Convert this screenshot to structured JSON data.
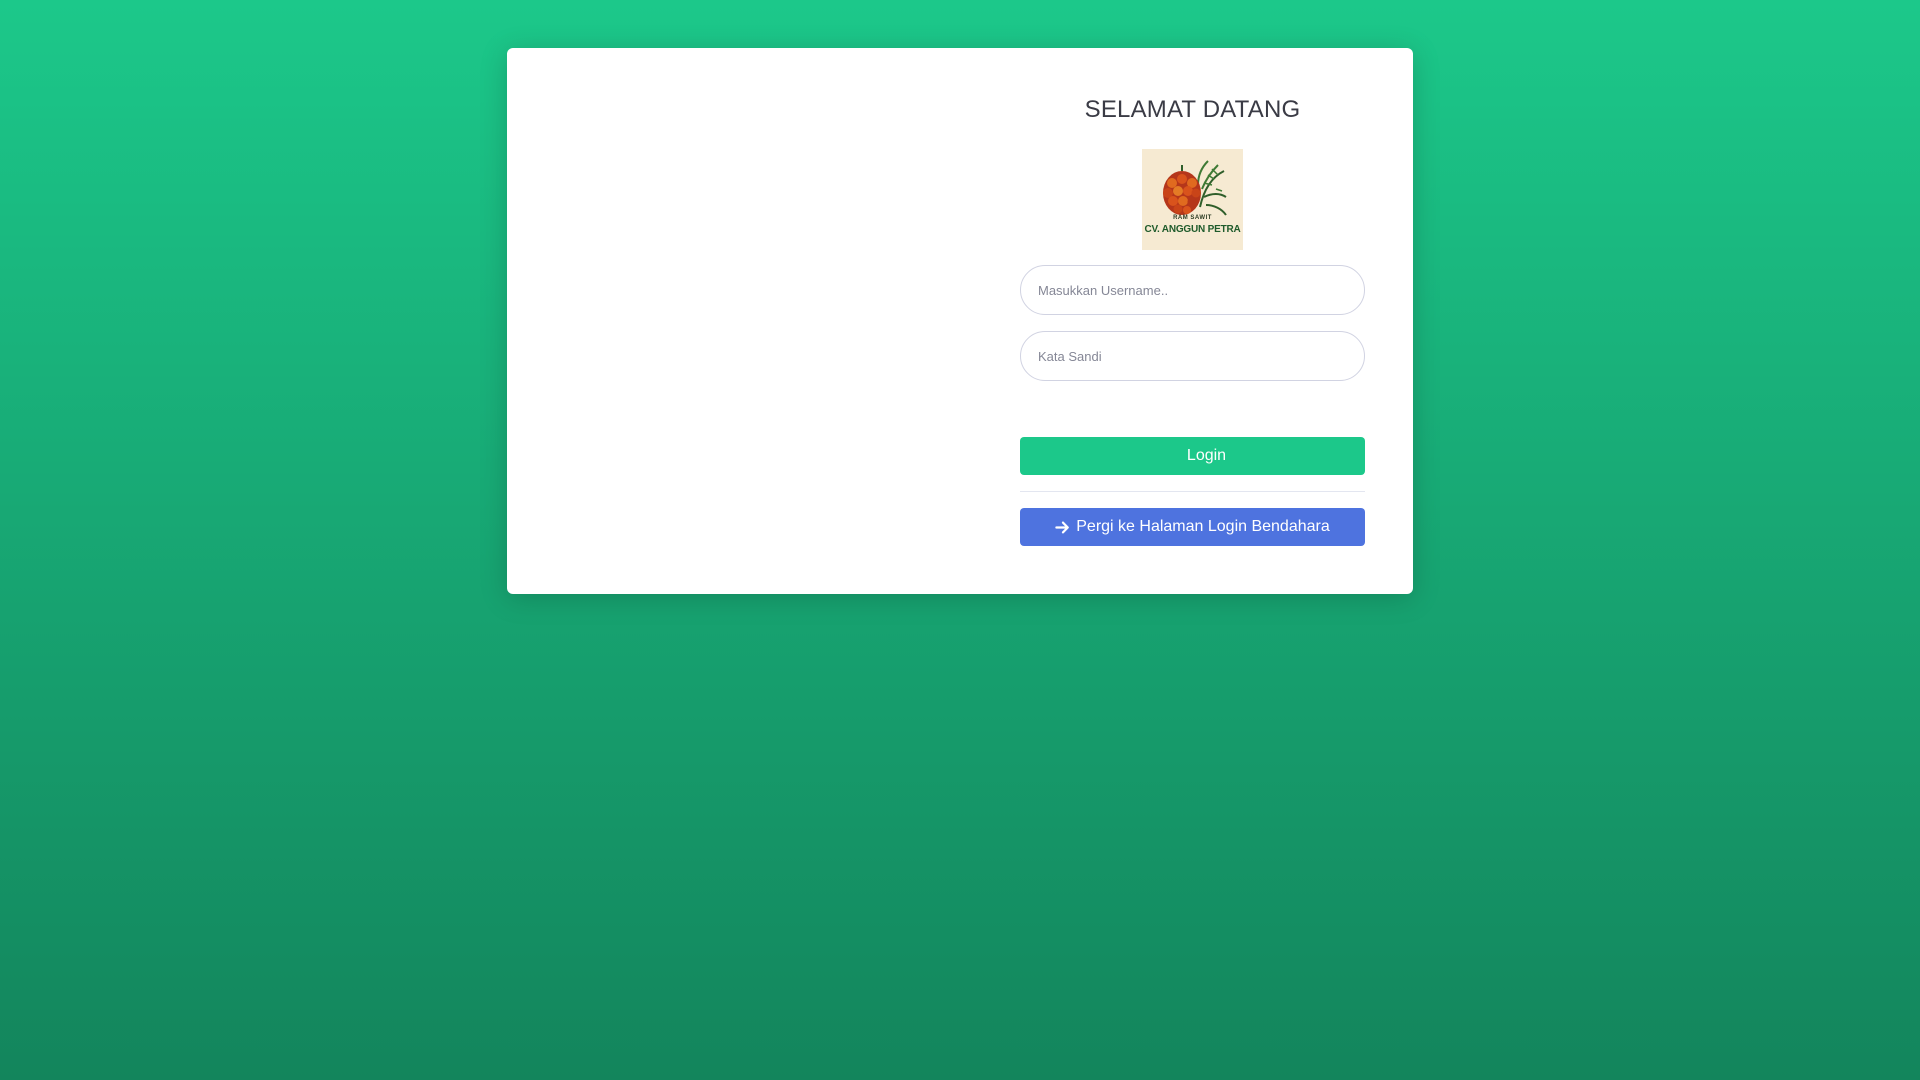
{
  "card": {
    "title": "SELAMAT DATANG",
    "logo": {
      "small_text": "RAM SAWIT",
      "company_text": "CV. ANGGUN PETRA"
    },
    "form": {
      "username": {
        "placeholder": "Masukkan Username..",
        "value": ""
      },
      "password": {
        "placeholder": "Kata Sandi",
        "value": ""
      },
      "login_label": "Login"
    },
    "bendahara_label": "Pergi ke Halaman Login Bendahara"
  },
  "icons": {
    "logo": "palm-fruit-icon",
    "bendahara": "arrow-right-icon"
  },
  "colors": {
    "background_top": "#1cc88a",
    "background_bottom": "#13855c",
    "login_button": "#1cc88a",
    "bendahara_button": "#4e73df",
    "title_text": "#3a3b45"
  }
}
